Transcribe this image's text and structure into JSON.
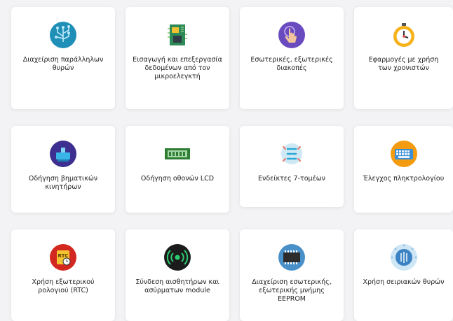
{
  "cards": [
    {
      "label": "Διαχείριση παράλληλων θυρών",
      "icon": "circuit-tree-icon"
    },
    {
      "label": "Εισαγωγή και επεξεργασία δεδομένων από τον μικροελεγκτή",
      "icon": "circuit-board-icon"
    },
    {
      "label": "Εσωτερικές, εξωτερικές διακοπές",
      "icon": "touch-button-icon"
    },
    {
      "label": "Εφαρμογές με χρήση των χρονιστών",
      "icon": "stopwatch-icon"
    },
    {
      "label": "Οδήγηση βηματικών κινητήρων",
      "icon": "stepper-motor-icon"
    },
    {
      "label": "Οδήγηση οθονών LCD",
      "icon": "lcd-display-icon"
    },
    {
      "label": "Ενδείκτες 7-τομέων",
      "icon": "seven-segment-icon"
    },
    {
      "label": "Έλεγχος πληκτρολογίου",
      "icon": "keyboard-icon"
    },
    {
      "label": "Χρήση εξωτερικού ρολογιού (RTC)",
      "icon": "rtc-clock-icon"
    },
    {
      "label": "Σύνδεση αισθητήρων και ασύρματων module",
      "icon": "wireless-signal-icon"
    },
    {
      "label": "Διαχείριση εσωτερικής, εξωτερικής μνήμης EEPROM",
      "icon": "memory-chip-icon"
    },
    {
      "label": "Χρήση σειριακών θυρών",
      "icon": "serial-port-icon"
    }
  ]
}
